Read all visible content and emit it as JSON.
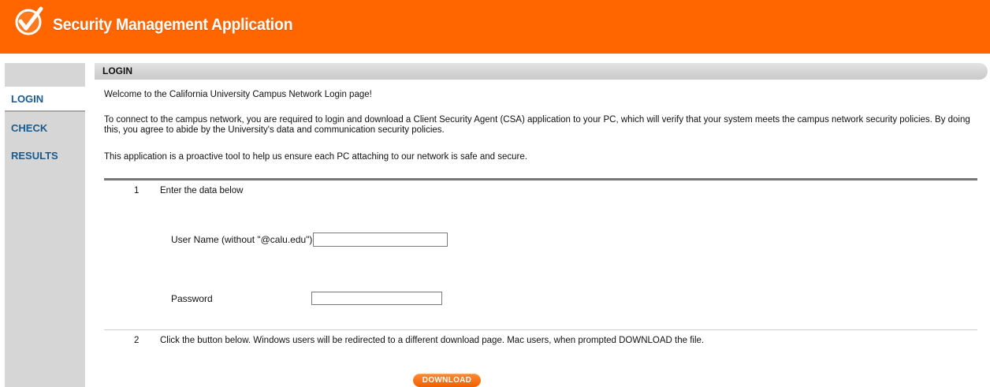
{
  "header": {
    "title": "Security Management Application",
    "logo_icon": "checkmark-circle-icon",
    "brand_color": "#ff6600"
  },
  "sidebar": {
    "items": [
      {
        "label": "LOGIN",
        "active": true
      },
      {
        "label": "CHECK",
        "active": false
      },
      {
        "label": "RESULTS",
        "active": false
      }
    ],
    "link_color": "#1a5a8c"
  },
  "main": {
    "section_title": "LOGIN",
    "welcome": "Welcome to the California University Campus Network Login page!",
    "connect_text": "To connect to the campus network, you are required to login and download a Client Security Agent (CSA) application to your PC, which will verify that your system meets the campus network security policies. By doing this, you agree to abide by the University's data and communication security policies.",
    "proactive_text": "This application is a proactive tool to help us ensure each PC attaching to our network is safe and secure.",
    "steps": [
      {
        "number": "1",
        "text": "Enter the data below"
      },
      {
        "number": "2",
        "text": "Click the button below. Windows users will be redirected to a different download page. Mac users, when prompted DOWNLOAD the file."
      }
    ],
    "form": {
      "username_label": "User Name (without \"@calu.edu\")",
      "username_value": "",
      "password_label": "Password",
      "password_value": ""
    },
    "download_label": "DOWNLOAD"
  }
}
